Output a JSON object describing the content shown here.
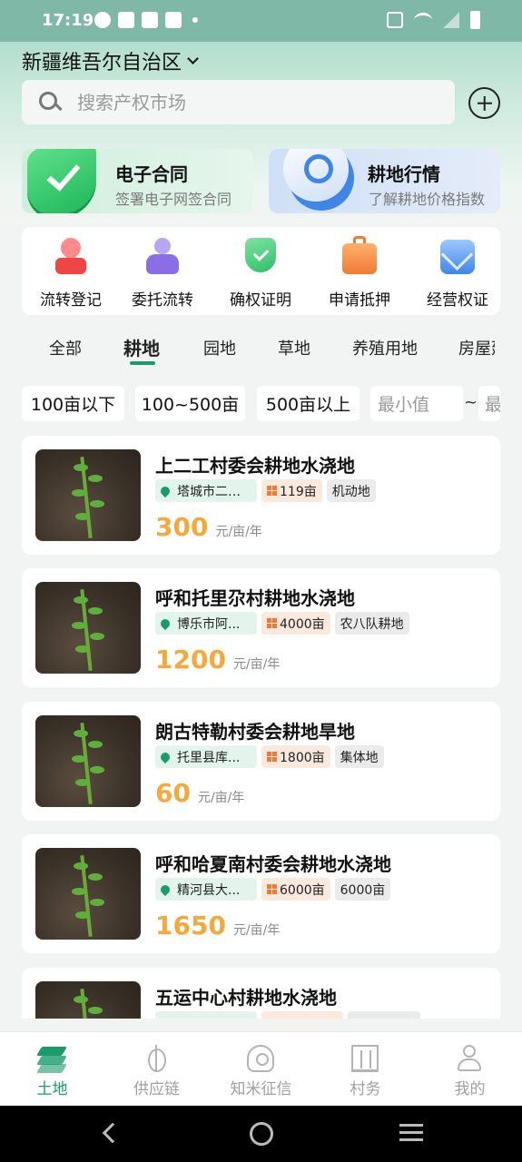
{
  "status_bar": {
    "time": "17:19"
  },
  "header": {
    "region": "新疆维吾尔自治区",
    "search_placeholder": "搜索产权市场"
  },
  "features": [
    {
      "title": "电子合同",
      "subtitle": "签署电子网签合同",
      "accent": "#1fb85a"
    },
    {
      "title": "耕地行情",
      "subtitle": "了解耕地价格指数",
      "accent": "#3f86e6"
    }
  ],
  "services": [
    {
      "label": "流转登记",
      "icon": "location-pin-icon"
    },
    {
      "label": "委托流转",
      "icon": "person-icon"
    },
    {
      "label": "确权证明",
      "icon": "shield-check-icon"
    },
    {
      "label": "申请抵押",
      "icon": "briefcase-icon"
    },
    {
      "label": "经营权证",
      "icon": "envelope-icon"
    }
  ],
  "tabs": {
    "items": [
      "全部",
      "耕地",
      "园地",
      "草地",
      "养殖用地",
      "房屋建筑"
    ],
    "active": "耕地"
  },
  "filters": {
    "chips": [
      "100亩以下",
      "100~500亩",
      "500亩以上"
    ],
    "min_placeholder": "最小值",
    "separator": "~",
    "max_placeholder": "最大值"
  },
  "listings": [
    {
      "title": "上二工村委会耕地水浇地",
      "location": "塔城市二工镇",
      "area": "119亩",
      "type": "机动地",
      "price": "300",
      "unit": "元/亩/年"
    },
    {
      "title": "呼和托里尕村耕地水浇地",
      "location": "博乐市阿...",
      "area": "4000亩",
      "type": "农八队耕地",
      "price": "1200",
      "unit": "元/亩/年"
    },
    {
      "title": "朗古特勒村委会耕地旱地",
      "location": "托里县库...",
      "area": "1800亩",
      "type": "集体地",
      "price": "60",
      "unit": "元/亩/年"
    },
    {
      "title": "呼和哈夏南村委会耕地水浇地",
      "location": "精河县大...",
      "area": "6000亩",
      "type": "6000亩",
      "price": "1650",
      "unit": "元/亩/年"
    },
    {
      "title": "五运中心村耕地水浇地",
      "location": "",
      "area": "",
      "type": "",
      "price": "",
      "unit": ""
    }
  ],
  "bottom_nav": [
    {
      "label": "土地",
      "icon": "layers-icon",
      "active": true
    },
    {
      "label": "供应链",
      "icon": "wheat-icon",
      "active": false
    },
    {
      "label": "知米征信",
      "icon": "badge-icon",
      "active": false
    },
    {
      "label": "村务",
      "icon": "building-icon",
      "active": false
    },
    {
      "label": "我的",
      "icon": "user-icon",
      "active": false
    }
  ],
  "colors": {
    "brand": "#1a9b6c",
    "price": "#f5a93c"
  }
}
